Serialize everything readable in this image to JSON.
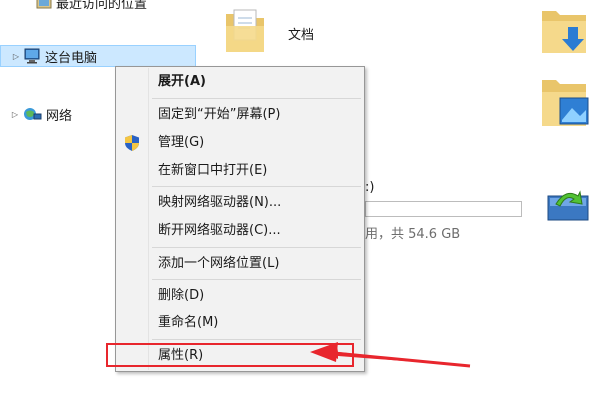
{
  "nav": {
    "recent_locations": "最近访问的位置",
    "this_pc": "这台电脑",
    "network": "网络"
  },
  "content": {
    "documents_label": "文档",
    "drive_label_fragment": ":)",
    "drive_space_fragment": "用，共 54.6 GB"
  },
  "context_menu": {
    "items": [
      {
        "label": "展开(A)"
      },
      {
        "label": "固定到“开始”屏幕(P)"
      },
      {
        "label": "管理(G)"
      },
      {
        "label": "在新窗口中打开(E)"
      },
      {
        "label": "映射网络驱动器(N)..."
      },
      {
        "label": "断开网络驱动器(C)..."
      },
      {
        "label": "添加一个网络位置(L)"
      },
      {
        "label": "删除(D)"
      },
      {
        "label": "重命名(M)"
      },
      {
        "label": "属性(R)"
      }
    ]
  },
  "colors": {
    "annotation_red": "#e8262d",
    "selection_blue": "#cce8ff"
  }
}
